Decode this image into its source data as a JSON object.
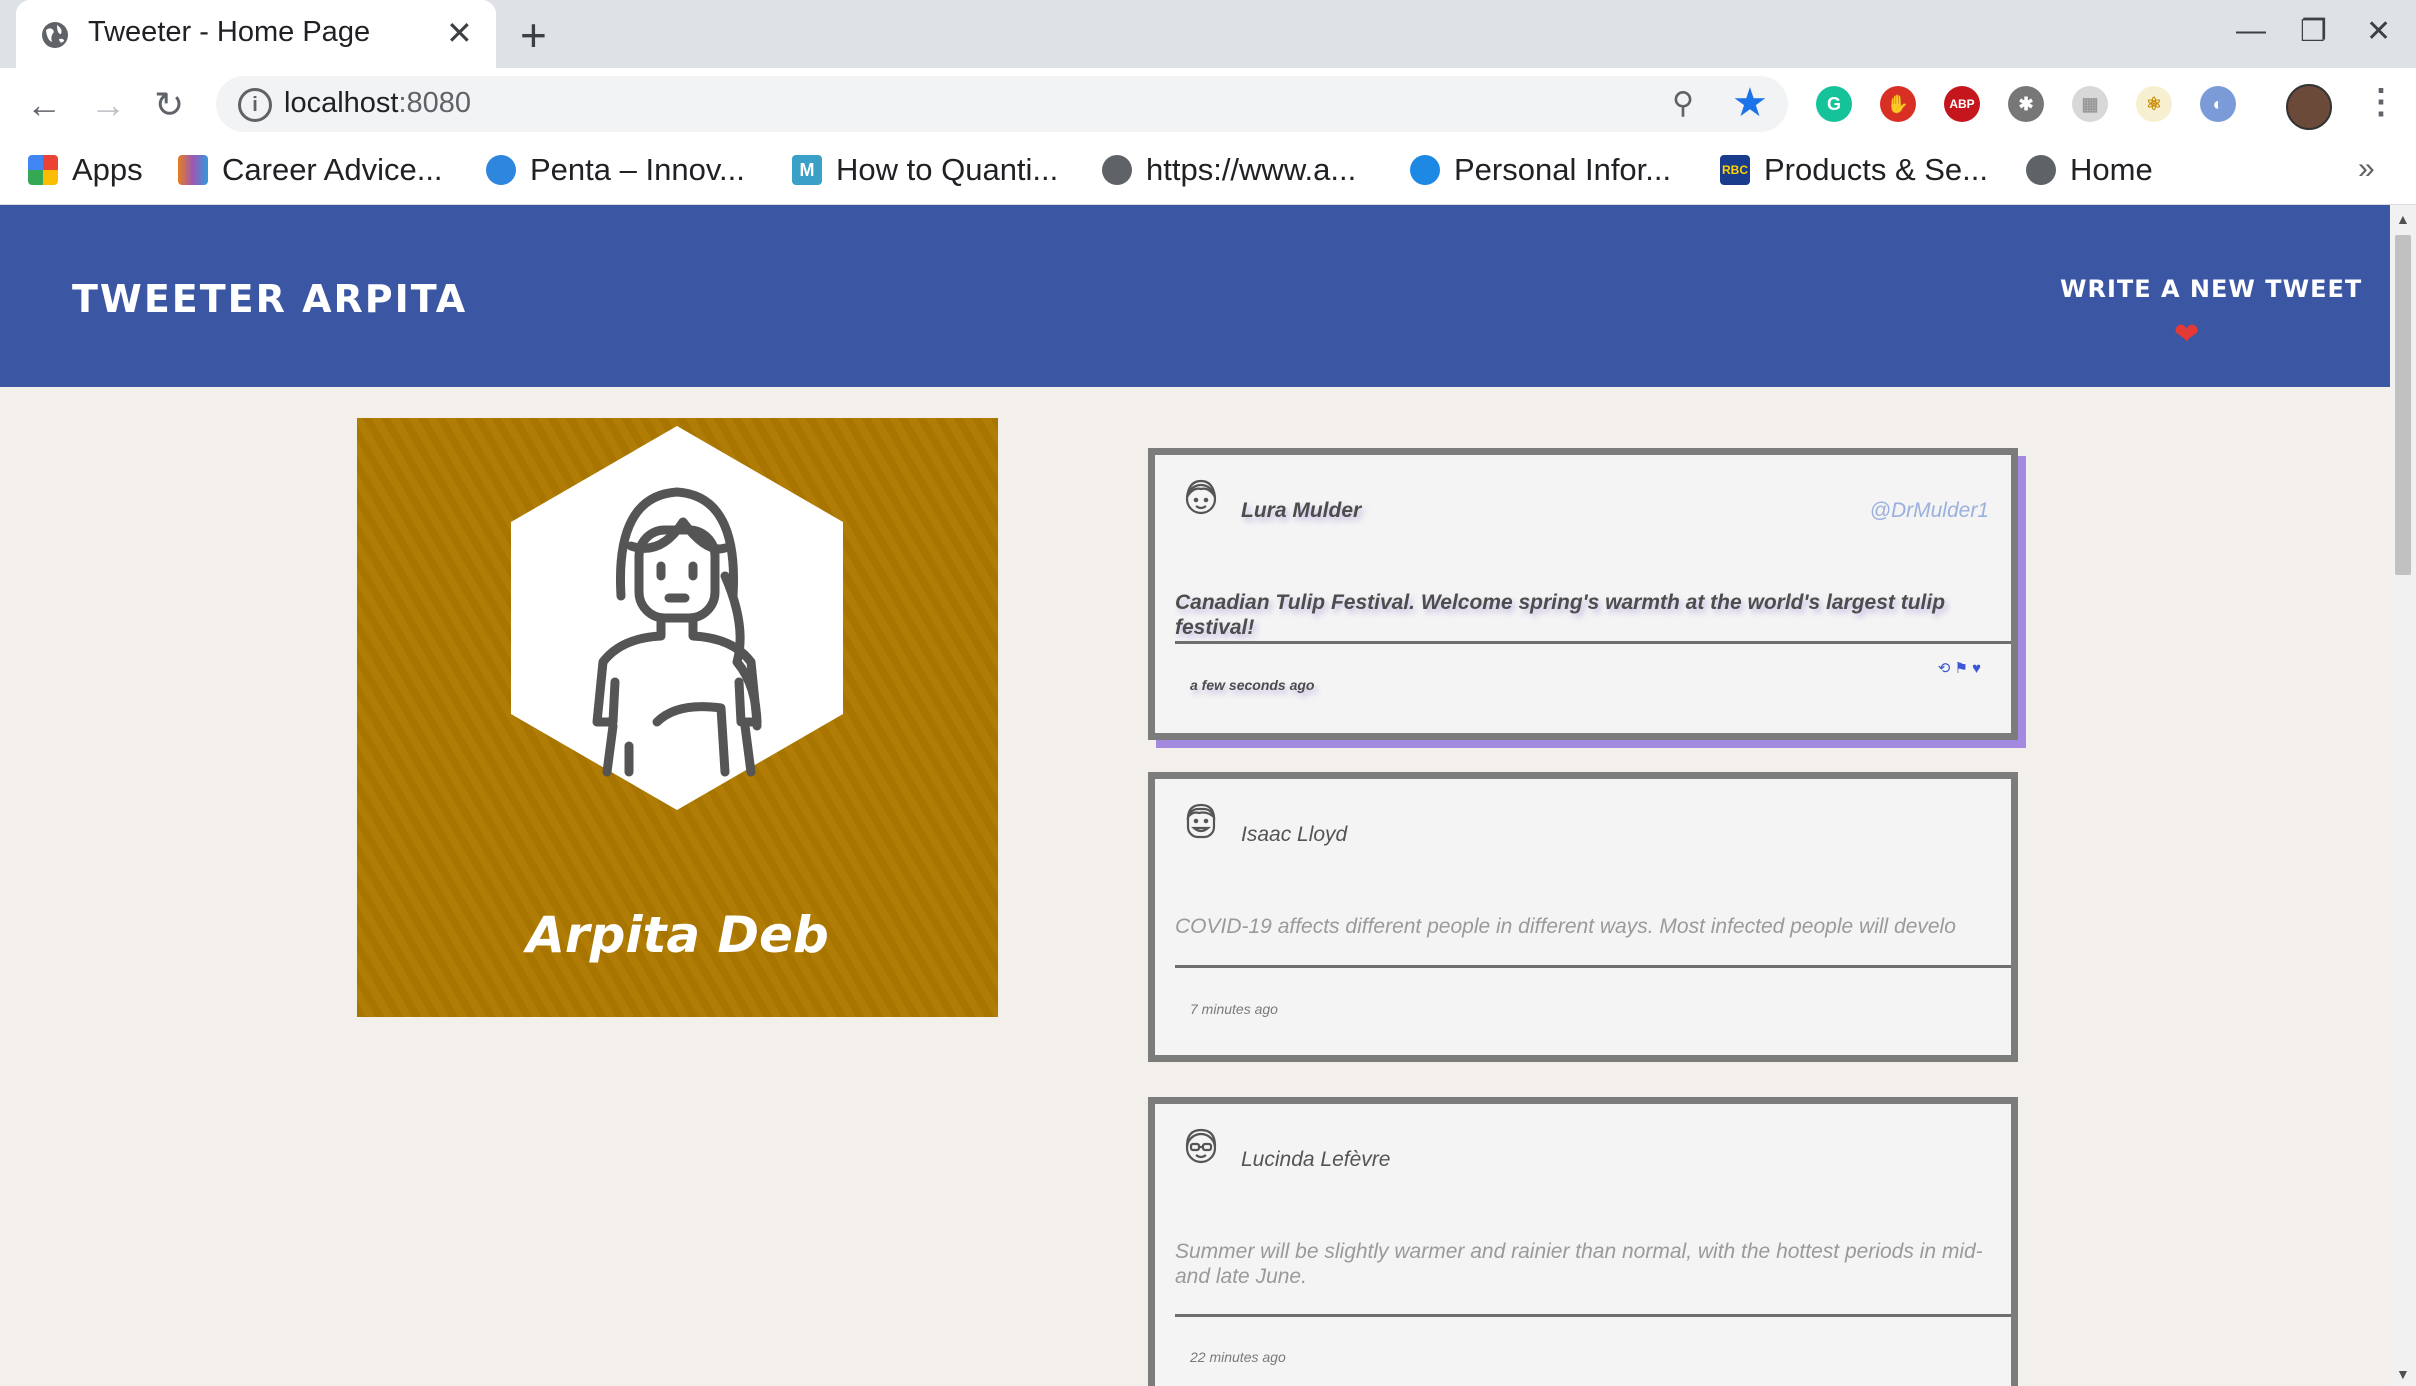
{
  "browser": {
    "tab_title": "Tweeter - Home Page",
    "tab_close": "✕",
    "new_tab": "+",
    "url_host": "localhost",
    "url_port": ":8080",
    "window_controls": [
      "—",
      "❐",
      "✕"
    ],
    "extensions": [
      {
        "name": "grammarly-icon",
        "label": "G",
        "color": "#15c39a"
      },
      {
        "name": "stop-icon",
        "label": "✋",
        "color": "#d93025"
      },
      {
        "name": "adblock-icon",
        "label": "ABP",
        "color": "#c4161c"
      },
      {
        "name": "bug-icon",
        "label": "✱",
        "color": "#777777"
      },
      {
        "name": "grid-ext-icon",
        "label": "▦",
        "color": "#d8d8d8"
      },
      {
        "name": "react-icon",
        "label": "⚛",
        "color": "#f0c040"
      },
      {
        "name": "mirror-icon",
        "label": "◐",
        "color": "#7a9ad8"
      }
    ],
    "more_menu": "⋮"
  },
  "bookmarks": [
    {
      "label": "Apps",
      "icon": "apps-grid-icon",
      "color": "#ea4335"
    },
    {
      "label": "Career Advice...",
      "icon": "career-icon",
      "color": "#e67e22"
    },
    {
      "label": "Penta – Innov...",
      "icon": "penta-icon",
      "color": "#2e86de"
    },
    {
      "label": "How to Quanti...",
      "icon": "medium-icon",
      "color": "#3aa0c8"
    },
    {
      "label": "https://www.a...",
      "icon": "globe-icon",
      "color": "#5f6368"
    },
    {
      "label": "Personal Infor...",
      "icon": "bulb-icon",
      "color": "#1e88e5"
    },
    {
      "label": "Products & Se...",
      "icon": "rbc-icon",
      "color": "#1a3c8c"
    },
    {
      "label": "Home",
      "icon": "globe-icon",
      "color": "#5f6368"
    }
  ],
  "bookmarks_overflow": "»",
  "header": {
    "brand": "Tweeter Arpita",
    "compose": "Write a new tweet",
    "compose_arrow": "❤"
  },
  "profile": {
    "name": "Arpita Deb"
  },
  "tweets": [
    {
      "author": "Lura Mulder",
      "handle": "@DrMulder1",
      "content": "Canadian Tulip Festival. Welcome spring's warmth at the world's largest tulip festival!",
      "time": "a few seconds ago",
      "actions": "⟲ ⚑ ♥"
    },
    {
      "author": "Isaac Lloyd",
      "handle": "",
      "content": "COVID-19 affects different people in different ways. Most infected people will develo",
      "time": "7 minutes ago",
      "actions": ""
    },
    {
      "author": "Lucinda Lefèvre",
      "handle": "",
      "content": "Summer will be slightly warmer and rainier than normal, with the hottest periods in mid- and late June.",
      "time": "22 minutes ago",
      "actions": ""
    }
  ]
}
